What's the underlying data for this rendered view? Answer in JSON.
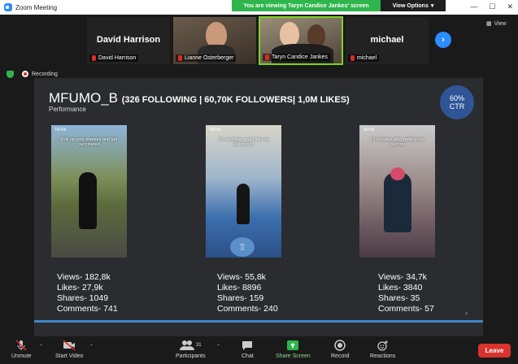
{
  "window": {
    "title": "Zoom Meeting"
  },
  "banner": {
    "message": "You are viewing Taryn Candice Jankes' screen",
    "options_label": "View Options"
  },
  "gallery": {
    "tiles": [
      {
        "big_name": "David Harrison",
        "tag": "David Harrison"
      },
      {
        "tag": "Lianne Osterberger"
      },
      {
        "tag": "Taryn Candice Jankes"
      },
      {
        "big_name": "michael",
        "tag": "michael"
      }
    ],
    "view_label": "View"
  },
  "recording": {
    "label": "Recording"
  },
  "slide": {
    "title": "MFUMO_B",
    "stats": "(326 FOLLOWING | 60,70K FOLLOWERS| 1,0M LIKES)",
    "subtitle": "Performance",
    "ctr_value": "60%",
    "ctr_label": "CTR",
    "videos": [
      {
        "caption": "Roll up your sleeves and get vaccinated",
        "badge": "TikTok",
        "views": "Views- 182,8k",
        "likes": "Likes- 27,9k",
        "shares": "Shares- 1049",
        "comments": "Comments- 741"
      },
      {
        "caption": "It's vaccines and vibes at Discovery",
        "badge": "TikTok",
        "views": "Views- 55,8k",
        "likes": "Likes- 8896",
        "shares": "Shares- 159",
        "comments": "Comments- 240"
      },
      {
        "caption": "15 minutes after getting the vaccine",
        "badge": "TikTok",
        "views": "Views- 34,7k",
        "likes": "Likes- 3840",
        "shares": "Shares- 35",
        "comments": "Comments- 57"
      }
    ],
    "progress_fraction": 1.0
  },
  "toolbar": {
    "unmute": "Unmute",
    "start_video": "Start Video",
    "participants": "Participants",
    "participants_count": "31",
    "chat": "Chat",
    "share_screen": "Share Screen",
    "record": "Record",
    "reactions": "Reactions",
    "leave": "Leave"
  },
  "colors": {
    "accent": "#2d8cff",
    "banner_green": "#2eb54c",
    "leave_red": "#d9332e",
    "ctr_blue": "#2f5597"
  }
}
